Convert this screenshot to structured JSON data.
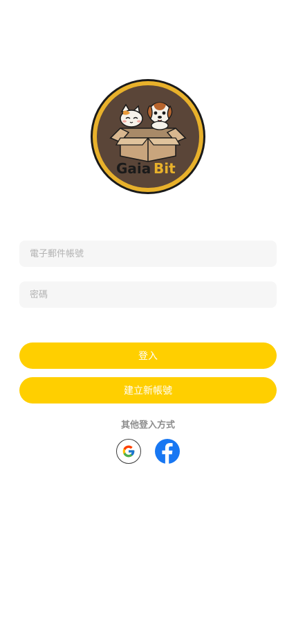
{
  "brand": {
    "logo_text_part1": "Gaia",
    "logo_text_part2": "Bit",
    "logo_icon": "cat-and-dog-in-box-logo"
  },
  "form": {
    "email_placeholder": "電子郵件帳號",
    "email_value": "",
    "password_placeholder": "密碼",
    "password_value": ""
  },
  "buttons": {
    "login_label": "登入",
    "register_label": "建立新帳號"
  },
  "social": {
    "label": "其他登入方式",
    "providers": [
      {
        "name": "google",
        "icon": "google-icon"
      },
      {
        "name": "facebook",
        "icon": "facebook-icon"
      }
    ]
  },
  "colors": {
    "accent": "#FFCF00",
    "logo_ring": "#E8B12B",
    "logo_fill": "#5A4538",
    "facebook": "#1877F2"
  }
}
